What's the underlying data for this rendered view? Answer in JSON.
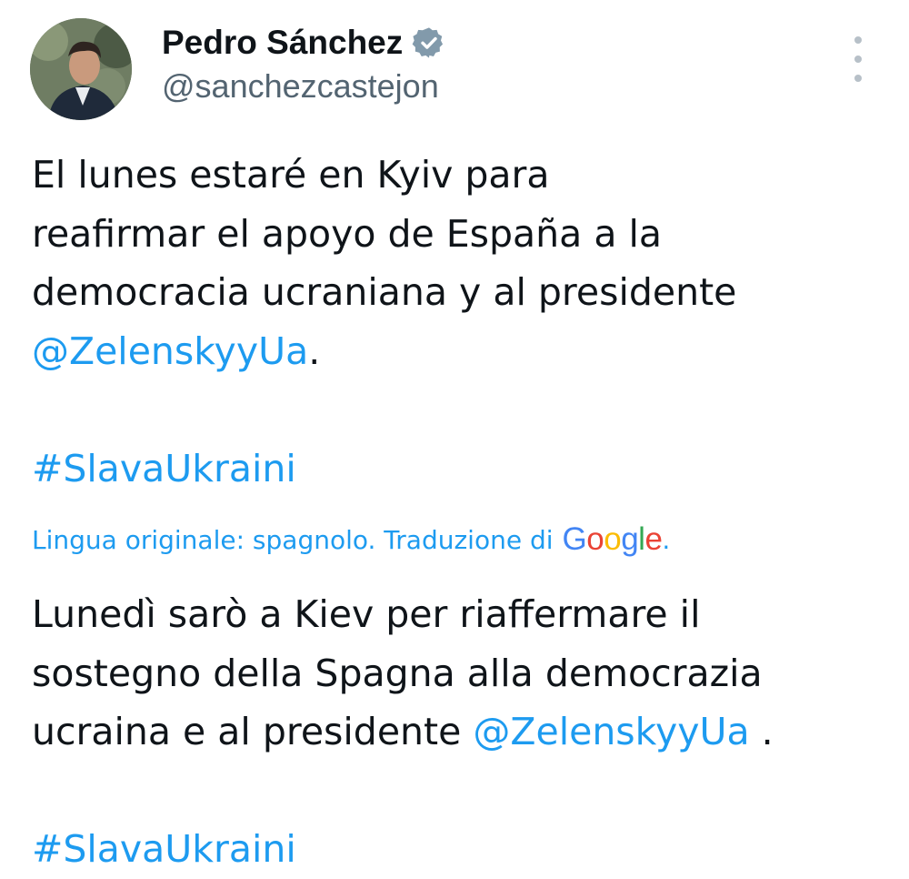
{
  "author": {
    "display_name": "Pedro Sánchez",
    "handle": "@sanchezcastejon",
    "verified": true,
    "verified_icon": "verified-badge-icon",
    "avatar_icon": "profile-photo"
  },
  "menu_icon": "more-vertical-icon",
  "tweet": {
    "line1": "El lunes estaré en Kyiv para",
    "line2": "reafirmar el apoyo de España a la",
    "line3": "democracia ucraniana y al presidente",
    "mention": "@ZelenskyyUa",
    "mention_suffix": ".",
    "hashtag": "#SlavaUkraini"
  },
  "translation": {
    "note": "Lingua originale: spagnolo. Traduzione di",
    "provider": "Google",
    "provider_letters": [
      "G",
      "o",
      "o",
      "g",
      "l",
      "e"
    ],
    "note_suffix": ".",
    "line1": "Lunedì sarò a Kiev per riaffermare il",
    "line2": "sostegno della Spagna alla democrazia",
    "line3_prefix": "ucraina e al presidente",
    "mention": "@ZelenskyyUa",
    "mention_suffix": ".",
    "hashtag": "#SlavaUkraini"
  },
  "colors": {
    "link": "#1d9bf0",
    "text": "#0f1419",
    "secondary": "#536471",
    "verified_badge": "#829aab"
  }
}
